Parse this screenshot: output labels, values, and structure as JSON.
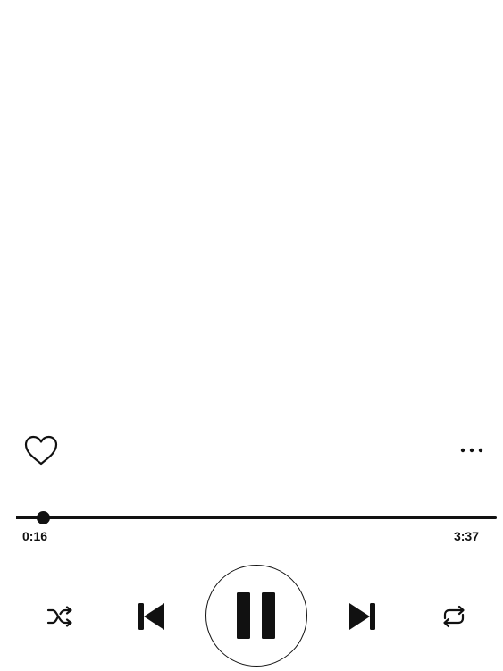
{
  "player": {
    "elapsed": "0:16",
    "duration": "3:37",
    "progress_fraction": 0.055
  },
  "icons": {
    "favorite": "heart-outline-icon",
    "more": "more-options-icon",
    "shuffle": "shuffle-icon",
    "previous": "skip-previous-icon",
    "pause": "pause-icon",
    "next": "skip-next-icon",
    "repeat": "repeat-icon"
  },
  "colors": {
    "background": "#ffffff",
    "foreground": "#111111"
  }
}
